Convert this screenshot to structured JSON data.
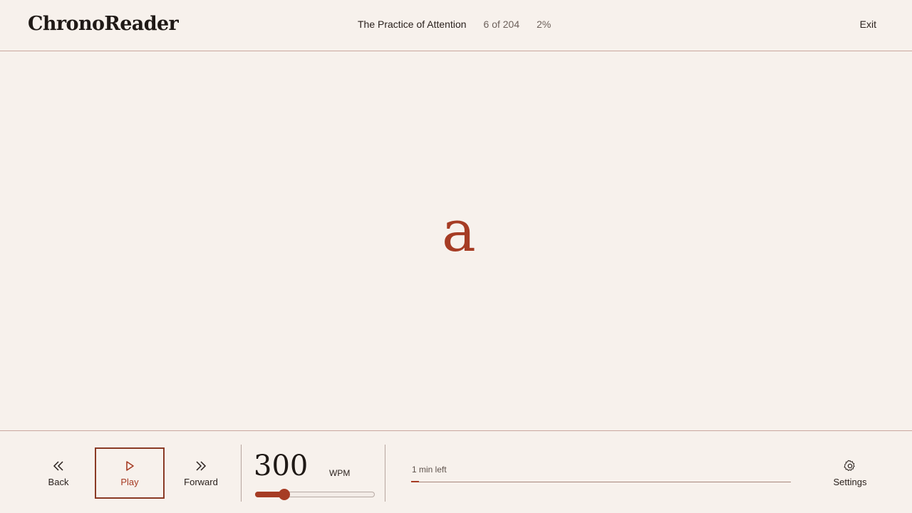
{
  "app": {
    "name": "ChronoReader"
  },
  "header": {
    "doc_title": "The Practice of Attention",
    "position": "6 of 204",
    "percent": "2%",
    "exit_label": "Exit"
  },
  "reader": {
    "current_word": "a"
  },
  "controls": {
    "back_label": "Back",
    "play_label": "Play",
    "forward_label": "Forward",
    "settings_label": "Settings",
    "wpm_value": "300",
    "wpm_unit": "WPM",
    "time_left": "1 min left",
    "progress_fraction": 0.02
  },
  "icons": {
    "back": "double-chevron-left-icon",
    "play": "play-triangle-icon",
    "forward": "double-chevron-right-icon",
    "settings": "gear-icon"
  },
  "colors": {
    "accent": "#a63c24",
    "background": "#f7f1ec",
    "divider": "#c9a79e"
  }
}
